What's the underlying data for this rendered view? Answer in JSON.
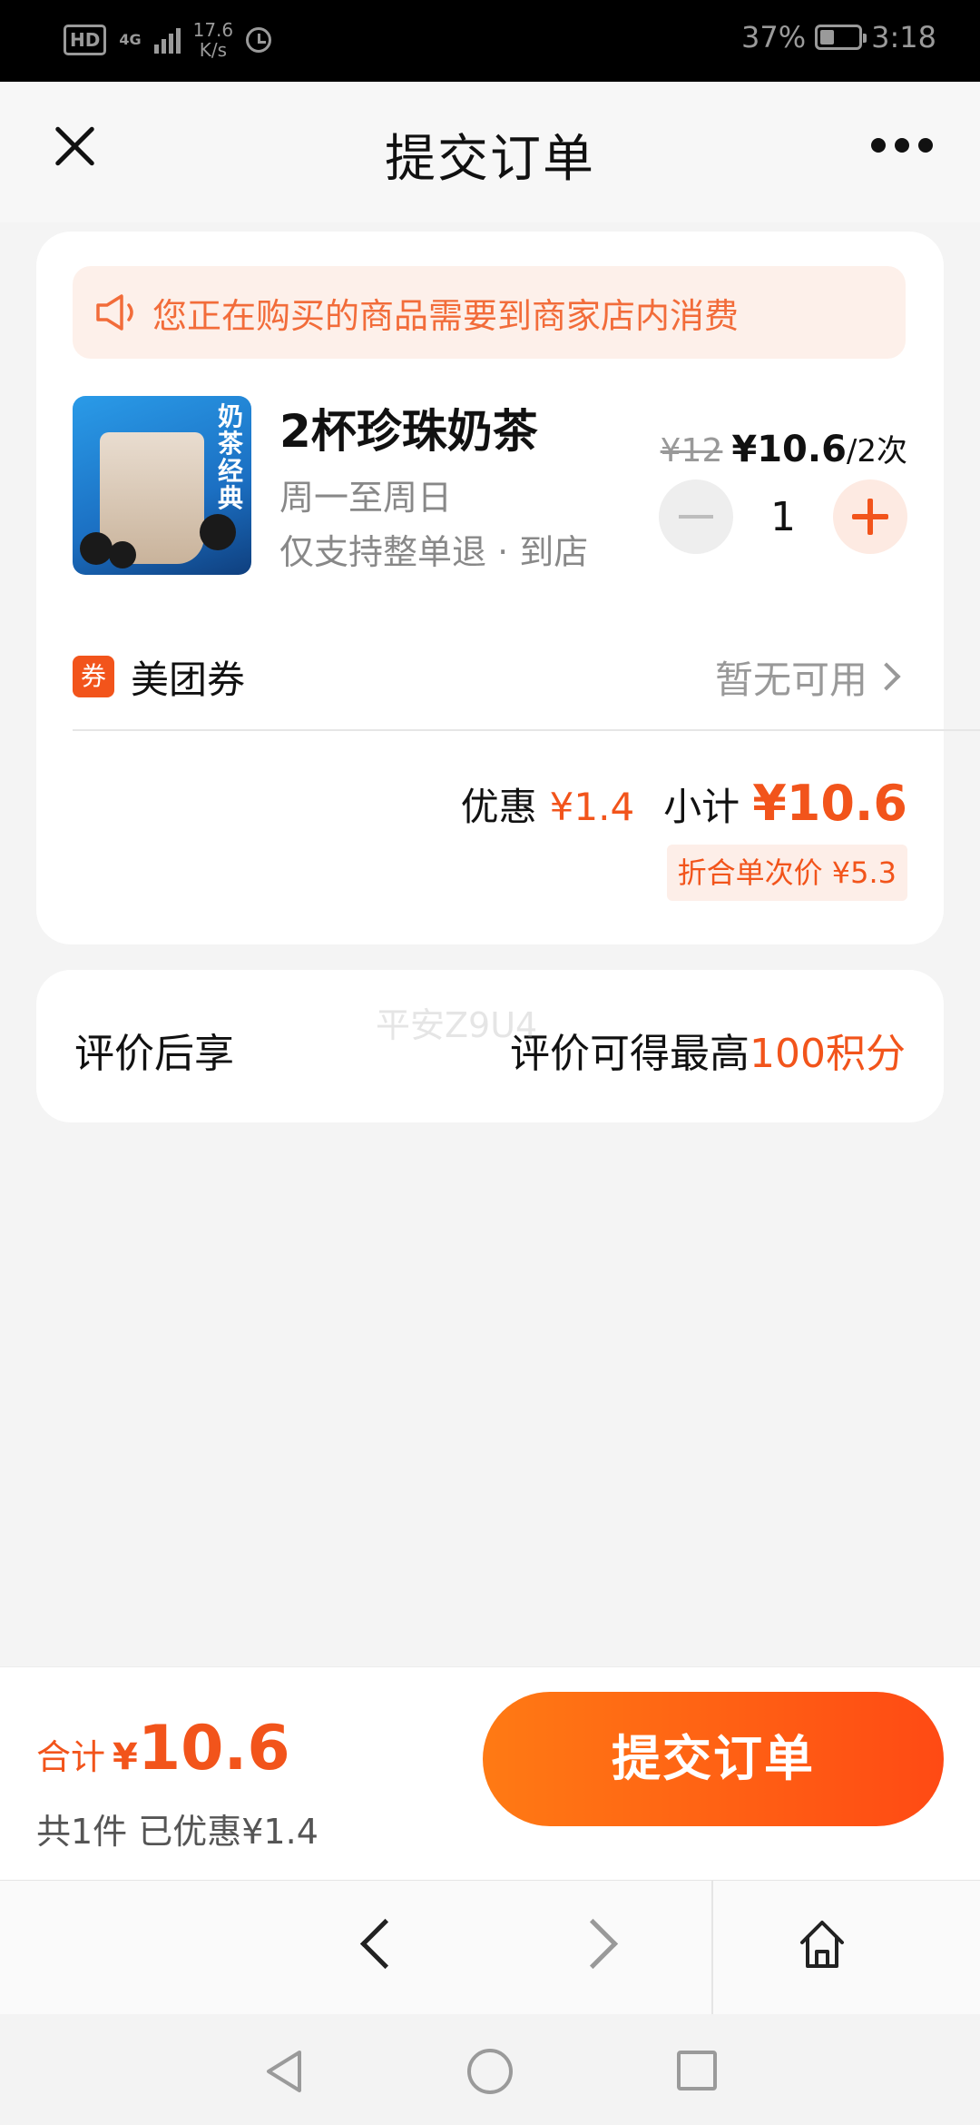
{
  "status_bar": {
    "hd": "HD",
    "network": "4G",
    "speed_value": "17.6",
    "speed_unit": "K/s",
    "battery": "37%",
    "time": "3:18",
    "battery_level": 0.37
  },
  "header": {
    "title": "提交订单"
  },
  "notice": {
    "text": "您正在购买的商品需要到商家店内消费"
  },
  "product": {
    "image_text": "奶茶经典",
    "name": "2杯珍珠奶茶",
    "days": "周一至周日",
    "refund": "仅支持整单退 · 到店",
    "price_original": "¥12",
    "price_current": "¥10.6",
    "price_unit": "/2次",
    "quantity": "1"
  },
  "coupon": {
    "tag": "券",
    "label": "美团券",
    "status": "暂无可用"
  },
  "summary": {
    "discount_label": "优惠",
    "discount_value": "¥1.4",
    "subtotal_label": "小计",
    "subtotal_value": "¥10.6",
    "unit_price": "折合单次价 ¥5.3"
  },
  "review": {
    "left": "评价后享",
    "right_prefix": "评价可得最高",
    "right_highlight": "100积分"
  },
  "watermark": "平安Z9U4",
  "bottom": {
    "total_label": "合计",
    "total_yen": "¥",
    "total_value": "10.6",
    "total_sub": "共1件  已优惠¥1.4",
    "submit_label": "提交订单"
  },
  "colors": {
    "accent": "#f2541b",
    "button_start": "#ff7a14",
    "button_end": "#ff4a14",
    "notice_bg": "#fdf0ea"
  }
}
